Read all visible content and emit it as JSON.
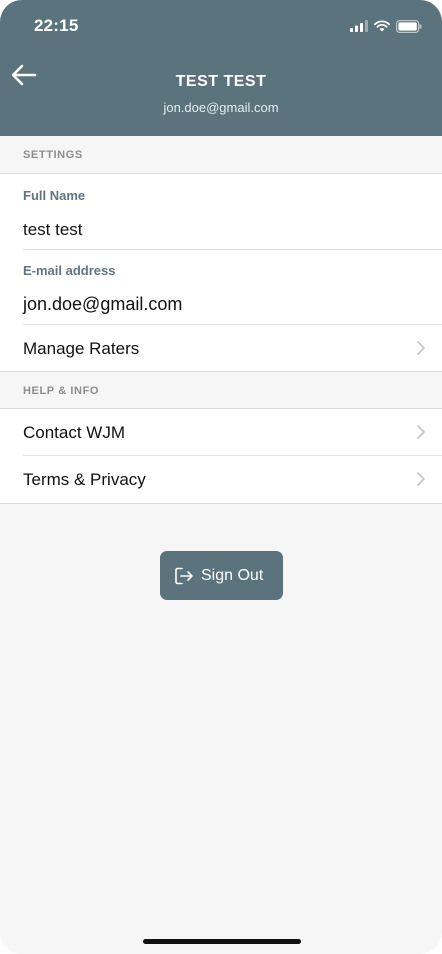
{
  "status_bar": {
    "time": "22:15"
  },
  "header": {
    "name": "TEST TEST",
    "email": "jon.doe@gmail.com"
  },
  "settings": {
    "section_title": "SETTINGS",
    "full_name": {
      "label": "Full Name",
      "value": "test test"
    },
    "email": {
      "label": "E-mail address",
      "value": "jon.doe@gmail.com"
    },
    "manage_raters": "Manage Raters"
  },
  "help": {
    "section_title": "HELP & INFO",
    "contact": "Contact WJM",
    "terms": "Terms & Privacy"
  },
  "sign_out": {
    "label": "Sign Out"
  },
  "colors": {
    "accent": "#5a737c",
    "background": "#f6f6f6"
  },
  "icons": [
    "back-arrow-icon",
    "signal-icon",
    "wifi-icon",
    "battery-icon",
    "chevron-right-icon",
    "sign-out-icon"
  ]
}
